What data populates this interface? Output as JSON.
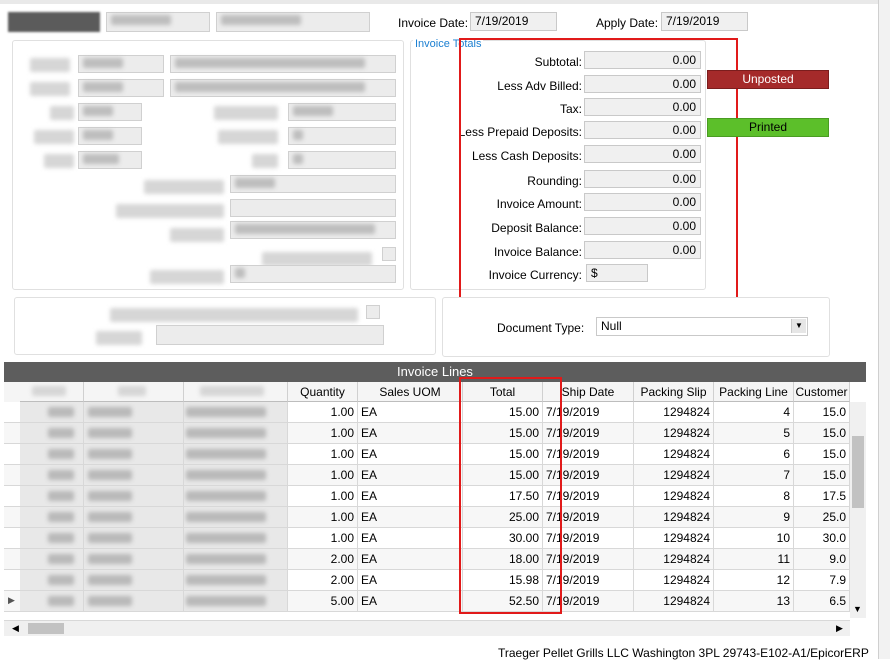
{
  "header": {
    "invoice_date_label": "Invoice Date:",
    "invoice_date": "7/19/2019",
    "apply_date_label": "Apply Date:",
    "apply_date": "7/19/2019"
  },
  "totals": {
    "group_label": "Invoice Totals",
    "subtotal_label": "Subtotal:",
    "subtotal": "0.00",
    "adv_billed_label": "Less Adv Billed:",
    "adv_billed": "0.00",
    "tax_label": "Tax:",
    "tax": "0.00",
    "prepaid_label": "Less Prepaid Deposits:",
    "prepaid": "0.00",
    "cash_deposits_label": "Less Cash Deposits:",
    "cash_deposits": "0.00",
    "rounding_label": "Rounding:",
    "rounding": "0.00",
    "invoice_amount_label": "Invoice Amount:",
    "invoice_amount": "0.00",
    "deposit_balance_label": "Deposit Balance:",
    "deposit_balance": "0.00",
    "invoice_balance_label": "Invoice Balance:",
    "invoice_balance": "0.00",
    "currency_label": "Invoice Currency:",
    "currency": "$"
  },
  "status": {
    "unposted": "Unposted",
    "printed": "Printed",
    "colors": {
      "unposted": "#a52a2a",
      "printed": "#5cbf2a",
      "highlight": "#e11a1a"
    }
  },
  "document_type": {
    "label": "Document Type:",
    "value": "Null"
  },
  "grid": {
    "title": "Invoice Lines",
    "columns": [
      "Quantity",
      "Sales UOM",
      "Total",
      "Ship Date",
      "Packing Slip",
      "Packing Line",
      "Customer"
    ],
    "rows": [
      {
        "qty": "1.00",
        "uom": "EA",
        "total": "15.00",
        "ship": "7/19/2019",
        "slip": "1294824",
        "line": "4",
        "cust": "15.0"
      },
      {
        "qty": "1.00",
        "uom": "EA",
        "total": "15.00",
        "ship": "7/19/2019",
        "slip": "1294824",
        "line": "5",
        "cust": "15.0"
      },
      {
        "qty": "1.00",
        "uom": "EA",
        "total": "15.00",
        "ship": "7/19/2019",
        "slip": "1294824",
        "line": "6",
        "cust": "15.0"
      },
      {
        "qty": "1.00",
        "uom": "EA",
        "total": "15.00",
        "ship": "7/19/2019",
        "slip": "1294824",
        "line": "7",
        "cust": "15.0"
      },
      {
        "qty": "1.00",
        "uom": "EA",
        "total": "17.50",
        "ship": "7/19/2019",
        "slip": "1294824",
        "line": "8",
        "cust": "17.5"
      },
      {
        "qty": "1.00",
        "uom": "EA",
        "total": "25.00",
        "ship": "7/19/2019",
        "slip": "1294824",
        "line": "9",
        "cust": "25.0"
      },
      {
        "qty": "1.00",
        "uom": "EA",
        "total": "30.00",
        "ship": "7/19/2019",
        "slip": "1294824",
        "line": "10",
        "cust": "30.0"
      },
      {
        "qty": "2.00",
        "uom": "EA",
        "total": "18.00",
        "ship": "7/19/2019",
        "slip": "1294824",
        "line": "11",
        "cust": "9.0"
      },
      {
        "qty": "2.00",
        "uom": "EA",
        "total": "15.98",
        "ship": "7/19/2019",
        "slip": "1294824",
        "line": "12",
        "cust": "7.9"
      },
      {
        "qty": "5.00",
        "uom": "EA",
        "total": "52.50",
        "ship": "7/19/2019",
        "slip": "1294824",
        "line": "13",
        "cust": "6.5"
      }
    ]
  },
  "statusbar": {
    "text": "Traeger Pellet Grills LLC  Washington 3PL  29743-E102-A1/EpicorERP"
  }
}
